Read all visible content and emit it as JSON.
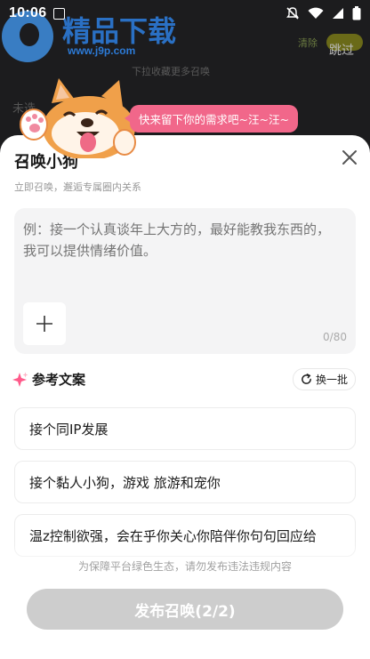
{
  "status_bar": {
    "time": "10:06"
  },
  "watermark": {
    "title": "精品下载",
    "url": "www.j9p.com"
  },
  "background": {
    "clear_label": "清除",
    "pill_label": "",
    "skip_label": "跳过",
    "hint": "下拉收藏更多召唤",
    "left_text": "未选"
  },
  "bubble_text": "快来留下你的需求吧~汪~汪~",
  "sheet": {
    "title": "召唤小狗",
    "subtitle": "立即召唤，邂逅专属圈内关系",
    "input": {
      "value": "",
      "placeholder": "例：接一个认真谈年上大方的，最好能教我东西的， 我可以提供情绪价值。",
      "counter": "0/80"
    },
    "reference": {
      "title": "参考文案",
      "refresh_label": "换一批",
      "items": [
        "接个同IP发展",
        "接个黏人小狗，游戏 旅游和宠你",
        "温z控制欲强，会在乎你关心你陪伴你句句回应给"
      ]
    },
    "notice": "为保障平台绿色生态，请勿发布违法违规内容",
    "publish_label": "发布召唤(2/2)"
  },
  "colors": {
    "accent_pink": "#f1678a",
    "button_disabled": "#cdcdcd",
    "sparkle": "#ff5a8a"
  }
}
